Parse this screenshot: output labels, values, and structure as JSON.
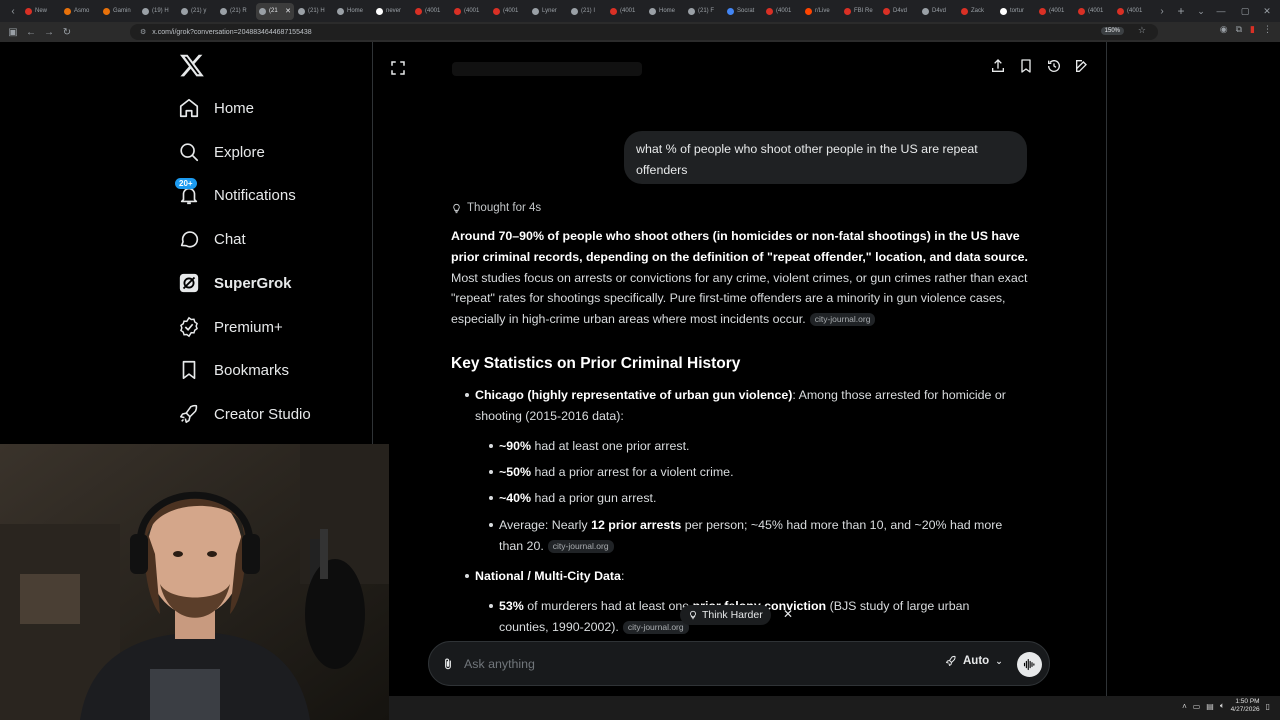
{
  "browser": {
    "tabs": [
      {
        "label": "New",
        "color": "#d93025"
      },
      {
        "label": "Asmo",
        "color": "#e8710a"
      },
      {
        "label": "Gamin",
        "color": "#e8710a"
      },
      {
        "label": "(19) H",
        "color": "#9aa0a6"
      },
      {
        "label": "(21) y",
        "color": "#9aa0a6"
      },
      {
        "label": "(21) R",
        "color": "#9aa0a6"
      },
      {
        "label": "(21",
        "color": "#9aa0a6",
        "active": true
      },
      {
        "label": "(21) H",
        "color": "#9aa0a6"
      },
      {
        "label": "Home",
        "color": "#9aa0a6"
      },
      {
        "label": "never",
        "color": "#ffffff"
      },
      {
        "label": "(4001",
        "color": "#d93025"
      },
      {
        "label": "(4001",
        "color": "#d93025"
      },
      {
        "label": "(4001",
        "color": "#d93025"
      },
      {
        "label": "Lyner",
        "color": "#9aa0a6"
      },
      {
        "label": "(21) I",
        "color": "#9aa0a6"
      },
      {
        "label": "(4001",
        "color": "#d93025"
      },
      {
        "label": "Home",
        "color": "#9aa0a6"
      },
      {
        "label": "(21) F",
        "color": "#9aa0a6"
      },
      {
        "label": "Socrat",
        "color": "#4285f4"
      },
      {
        "label": "(4001",
        "color": "#d93025"
      },
      {
        "label": "r/Live",
        "color": "#ff4500"
      },
      {
        "label": "FBI Re",
        "color": "#d93025"
      },
      {
        "label": "D4vd",
        "color": "#d93025"
      },
      {
        "label": "D4vd",
        "color": "#9aa0a6"
      },
      {
        "label": "Zack",
        "color": "#d93025"
      },
      {
        "label": "tortur",
        "color": "#ffffff"
      },
      {
        "label": "(4001",
        "color": "#d93025"
      },
      {
        "label": "(4001",
        "color": "#d93025"
      },
      {
        "label": "(4001",
        "color": "#d93025"
      }
    ],
    "url": "x.com/i/grok?conversation=2048834644687155438",
    "zoom": "150%"
  },
  "sidebar": {
    "items": [
      {
        "label": "Home"
      },
      {
        "label": "Explore"
      },
      {
        "label": "Notifications",
        "badge": "20+"
      },
      {
        "label": "Chat"
      },
      {
        "label": "SuperGrok"
      },
      {
        "label": "Premium+"
      },
      {
        "label": "Bookmarks"
      },
      {
        "label": "Creator Studio"
      }
    ]
  },
  "chat": {
    "user_message": "what % of people who shoot other people in the US are repeat offenders",
    "thought_label": "Thought for 4s",
    "intro_bold": "Around 70–90% of people who shoot others (in homicides or non-fatal shootings) in the US have prior criminal records, depending on the definition of \"repeat offender,\" location, and data source.",
    "intro_rest": " Most studies focus on arrests or convictions for any crime, violent crimes, or gun crimes rather than exact \"repeat\" rates for shootings specifically. Pure first-time offenders are a minority in gun violence cases, especially in high-crime urban areas where most incidents occur.",
    "source": "city-journal.org",
    "heading": "Key Statistics on Prior Criminal History",
    "chicago_bold": "Chicago (highly representative of urban gun violence)",
    "chicago_rest": ": Among those arrested for homicide or shooting (2015-2016 data):",
    "b1_bold": "~90%",
    "b1_rest": " had at least one prior arrest.",
    "b2_bold": "~50%",
    "b2_rest": " had a prior arrest for a violent crime.",
    "b3_bold": "~40%",
    "b3_rest": " had a prior gun arrest.",
    "b4_pre": "Average: Nearly ",
    "b4_bold": "12 prior arrests",
    "b4_rest": " per person; ~45% had more than 10, and ~20% had more than 20.",
    "national_bold": "National / Multi-City Data",
    "national_rest": ":",
    "n1_bold": "53%",
    "n1_mid": " of murderers had at least one ",
    "n1_bold2": "prior felony conviction",
    "n1_rest": " (BJS study of large urban counties, 1990-2002)."
  },
  "think_harder": "Think Harder",
  "input": {
    "placeholder": "Ask anything",
    "mode": "Auto"
  },
  "taskbar": {
    "time": "1:50 PM",
    "date": "4/27/2026"
  }
}
